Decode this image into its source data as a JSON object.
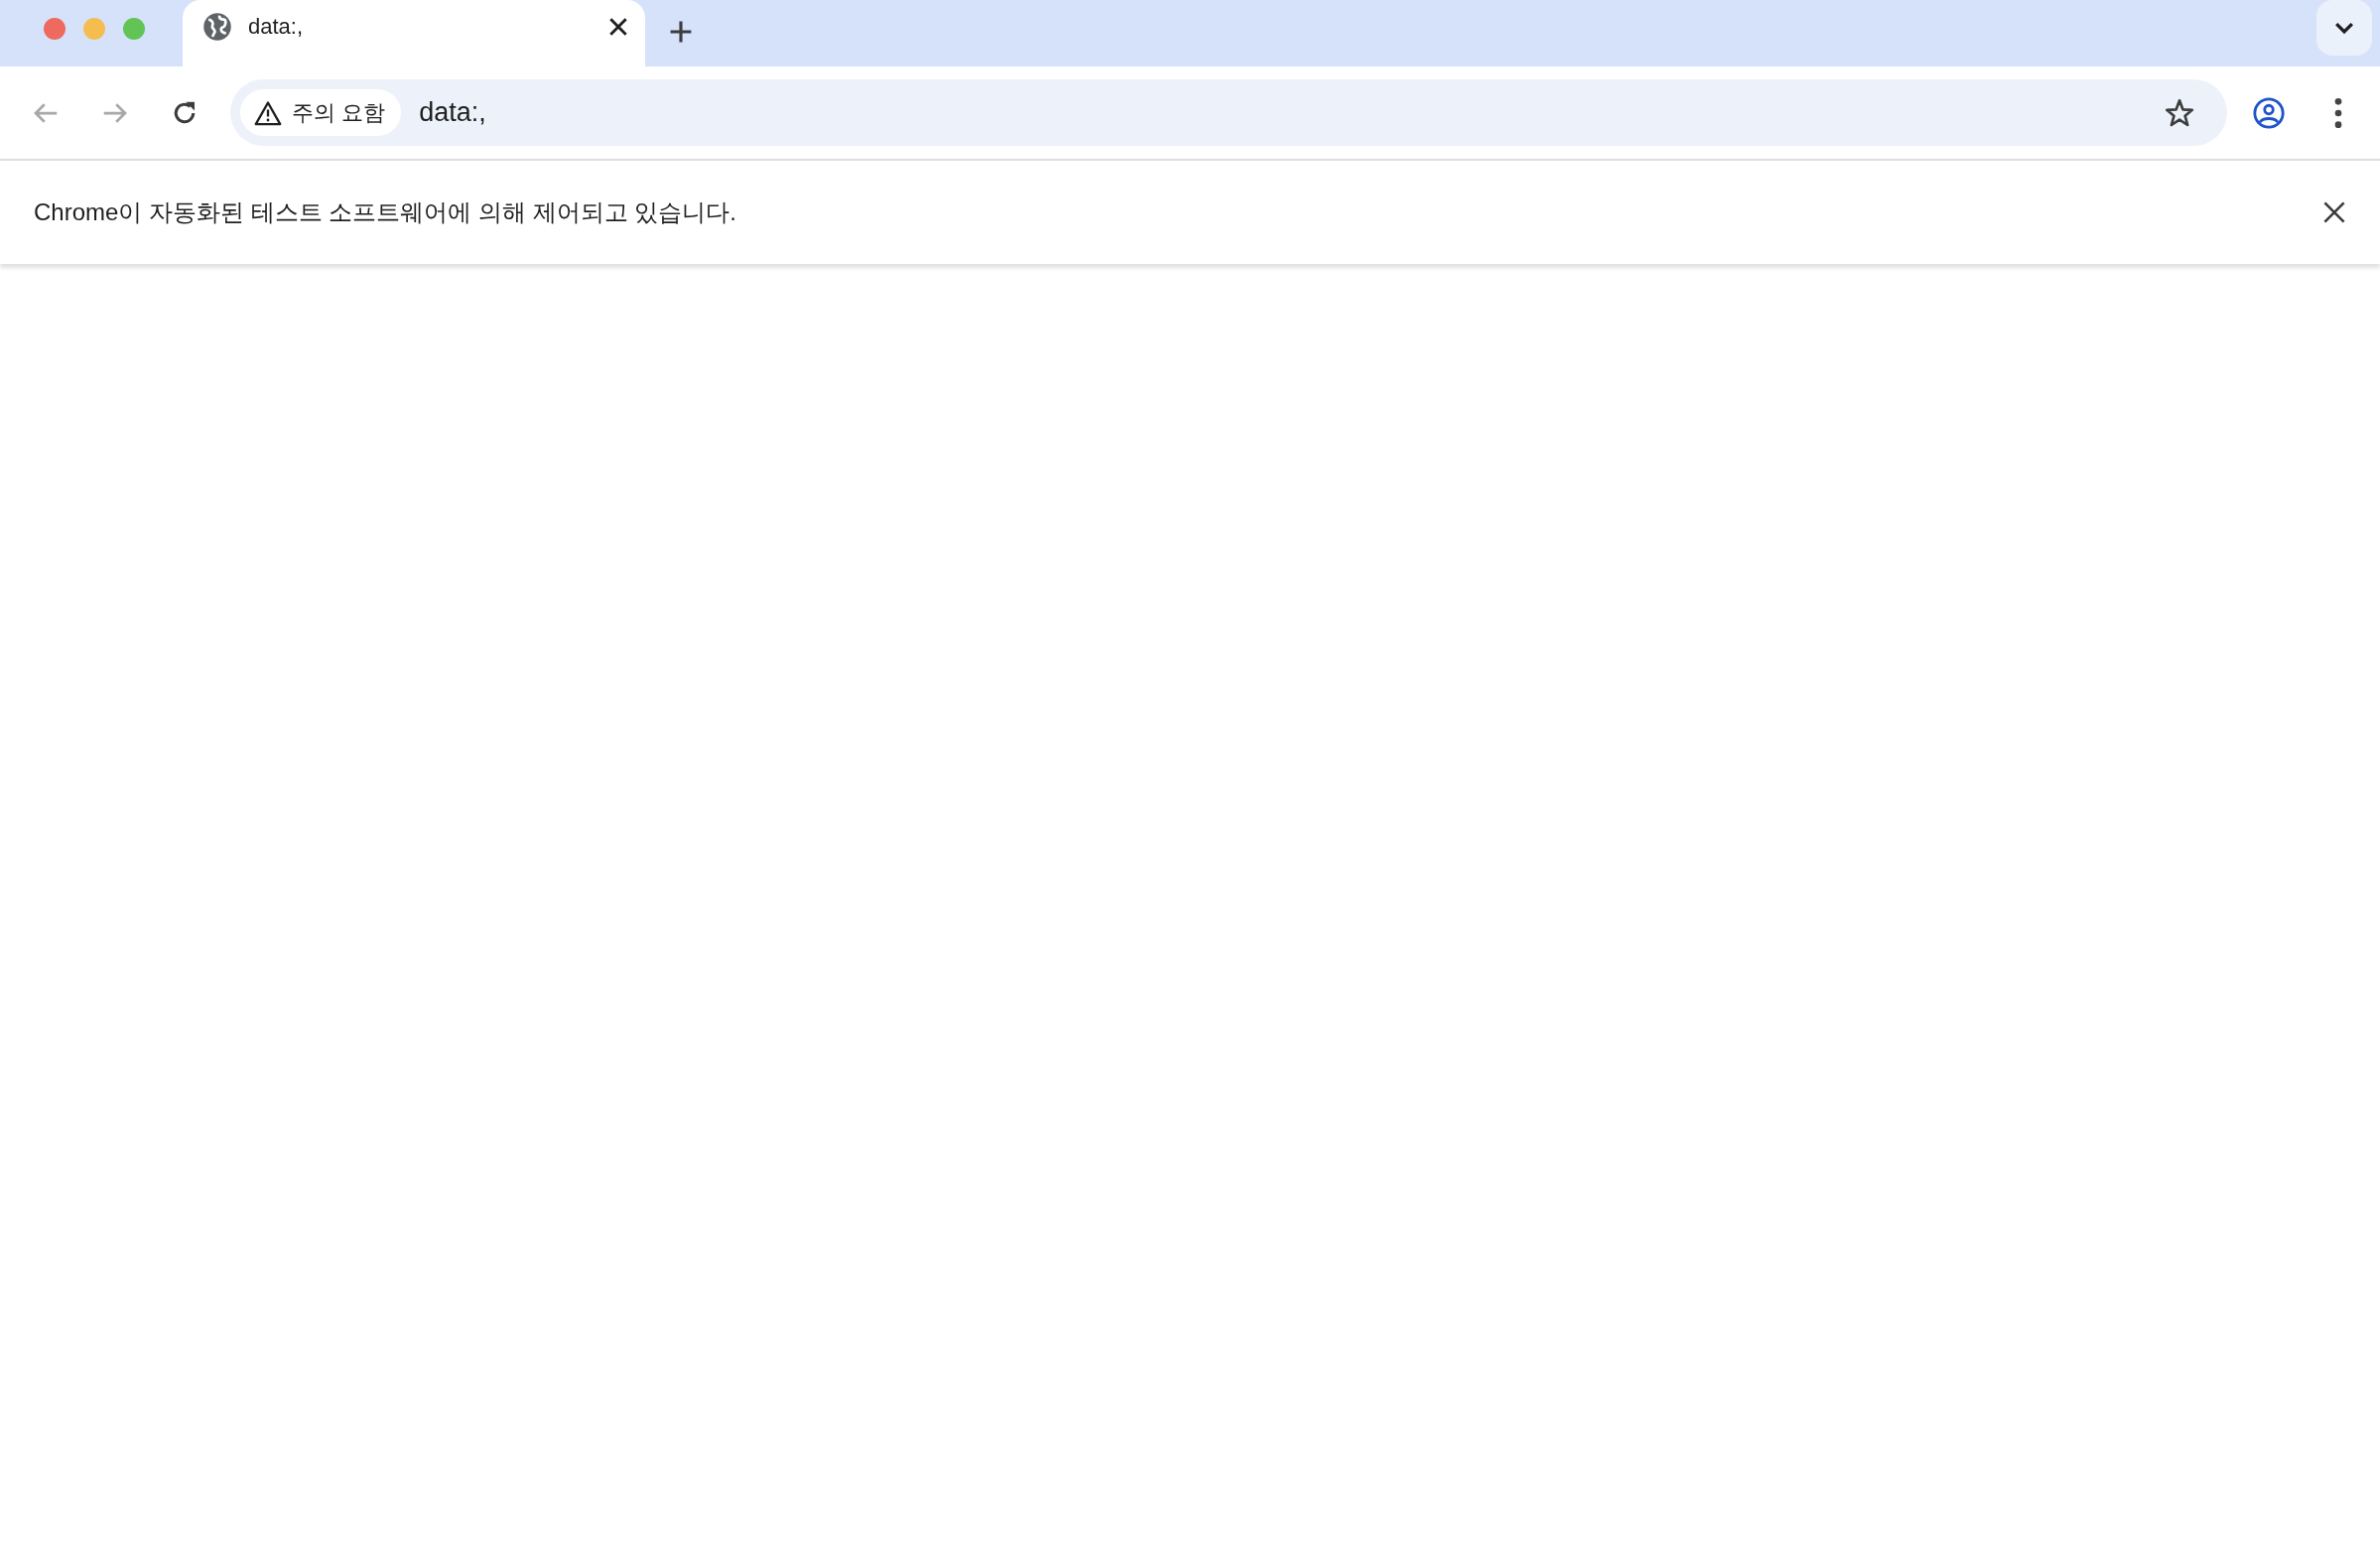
{
  "tabs": [
    {
      "title": "data:,",
      "selected": true
    }
  ],
  "toolbar": {
    "security_chip": "주의 요함",
    "url": "data:,"
  },
  "infobar": {
    "message": "Chrome이 자동화된 테스트 소프트웨어에 의해 제어되고 있습니다."
  }
}
